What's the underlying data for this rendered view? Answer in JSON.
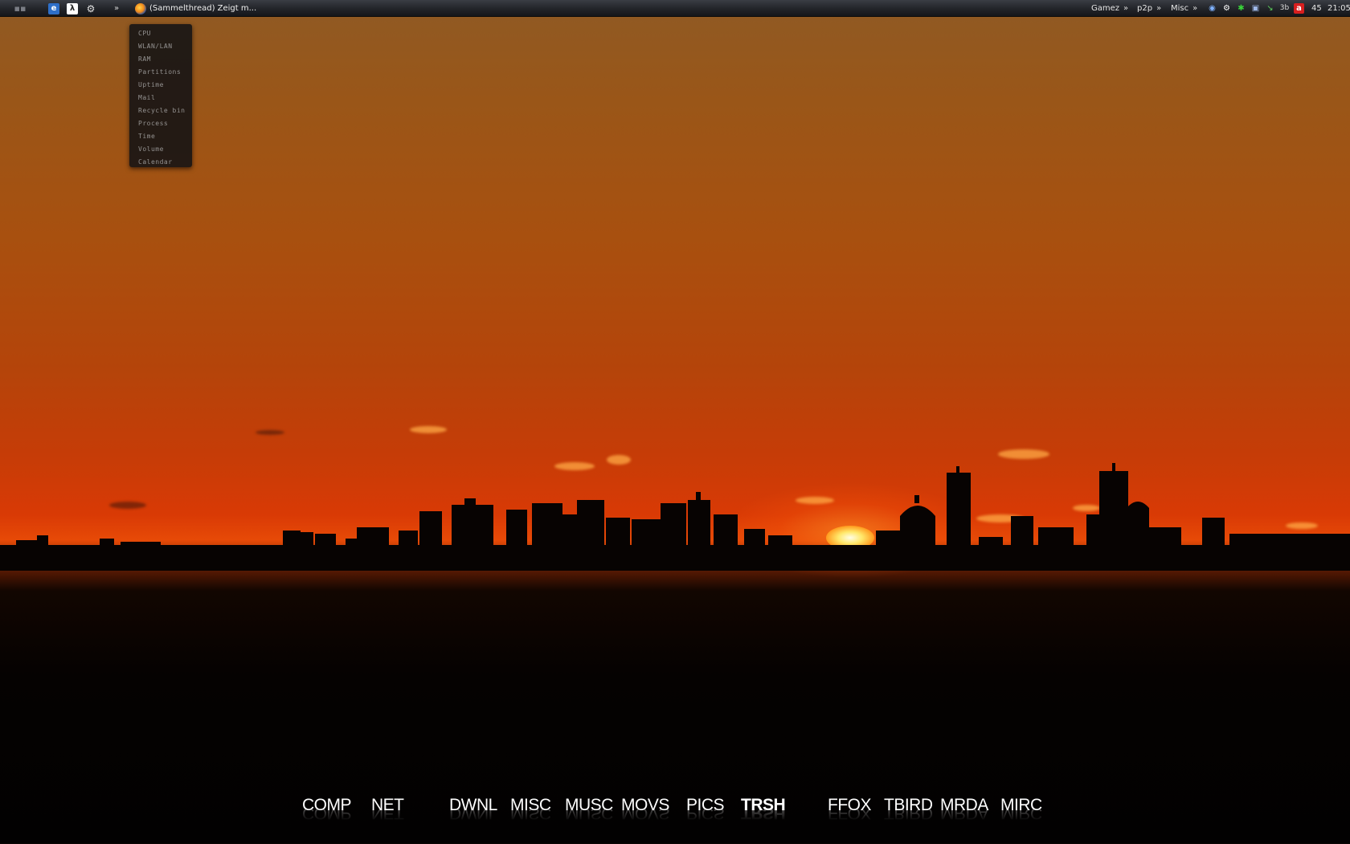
{
  "taskbar": {
    "start_icon": "grid-icon",
    "quick_launch": [
      {
        "name": "ie-icon",
        "color": "#3b7ed8"
      },
      {
        "name": "halflife-icon",
        "color": "#ffffff"
      },
      {
        "name": "steam-icon",
        "color": "#e0e0e0"
      }
    ],
    "overflow_chevron": "»",
    "active_task": {
      "icon": "firefox-icon",
      "title": "(Sammelthread) Zeigt m..."
    },
    "menus": [
      {
        "label": "Gamez",
        "chevron": "»"
      },
      {
        "label": "p2p",
        "chevron": "»"
      },
      {
        "label": "Misc",
        "chevron": "»"
      }
    ],
    "tray_icons": [
      "network-icon",
      "steam-tray-icon",
      "green-gear-icon",
      "monitor-icon",
      "arrow-icon",
      "3b-icon",
      "avira-icon"
    ],
    "volume": "45",
    "clock": "21:05"
  },
  "popup_menu": {
    "items": [
      "CPU",
      "WLAN/LAN",
      "RAM",
      "Partitions",
      "Uptime",
      "Mail",
      "Recycle bin",
      "Process",
      "Time",
      "Volume",
      "Calendar"
    ]
  },
  "dock": {
    "items": [
      {
        "label": "COMP",
        "active": false
      },
      {
        "label": "NET",
        "active": false
      },
      {
        "label": "DWNL",
        "active": false
      },
      {
        "label": "MISC",
        "active": false
      },
      {
        "label": "MUSC",
        "active": false
      },
      {
        "label": "MOVS",
        "active": false
      },
      {
        "label": "PICS",
        "active": false
      },
      {
        "label": "TRSH",
        "active": true
      },
      {
        "label": "FFOX",
        "active": false
      },
      {
        "label": "TBIRD",
        "active": false
      },
      {
        "label": "MRDA",
        "active": false
      },
      {
        "label": "MIRC",
        "active": false
      }
    ]
  },
  "colors": {
    "sky_top": "#8f5a24",
    "sky_mid": "#b5440a",
    "sky_horizon": "#e74a07",
    "sun": "#ffe86a",
    "ground": "#050201",
    "taskbar": "#24262b"
  }
}
